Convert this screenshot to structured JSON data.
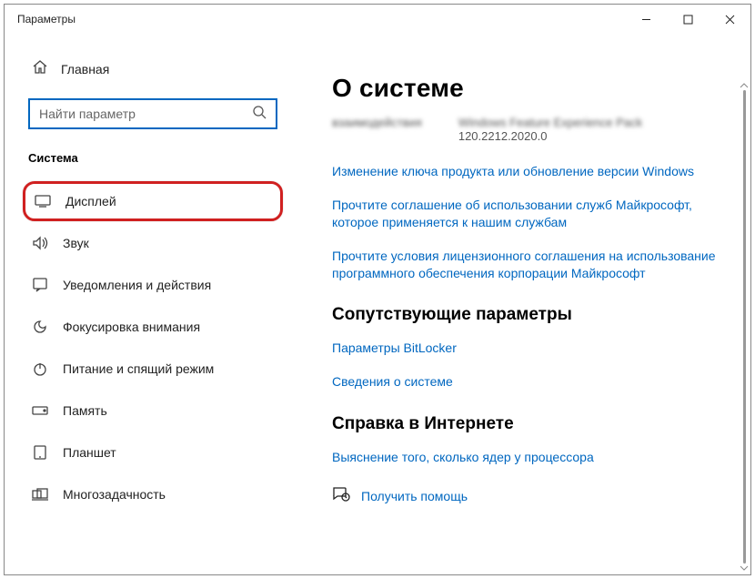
{
  "window": {
    "title": "Параметры"
  },
  "home": {
    "label": "Главная"
  },
  "search": {
    "placeholder": "Найти параметр"
  },
  "section": {
    "title": "Система"
  },
  "nav": {
    "items": [
      {
        "label": "Дисплей"
      },
      {
        "label": "Звук"
      },
      {
        "label": "Уведомления и действия"
      },
      {
        "label": "Фокусировка внимания"
      },
      {
        "label": "Питание и спящий режим"
      },
      {
        "label": "Память"
      },
      {
        "label": "Планшет"
      },
      {
        "label": "Многозадачность"
      }
    ]
  },
  "main": {
    "heading": "О системе",
    "blur_left": "взаимодействия",
    "blur_right": "Windows Feature Experience Pack",
    "version_line": "120.2212.2020.0",
    "links": [
      "Изменение ключа продукта или обновление версии Windows",
      "Прочтите соглашение об использовании служб Майкрософт, которое применяется к нашим службам",
      "Прочтите условия лицензионного соглашения на использование программного обеспечения корпорации Майкрософт"
    ],
    "related_heading": "Сопутствующие параметры",
    "related_links": [
      "Параметры BitLocker",
      "Сведения о системе"
    ],
    "help_heading": "Справка в Интернете",
    "help_link": "Выяснение того, сколько ядер у процессора",
    "get_help": "Получить помощь"
  }
}
